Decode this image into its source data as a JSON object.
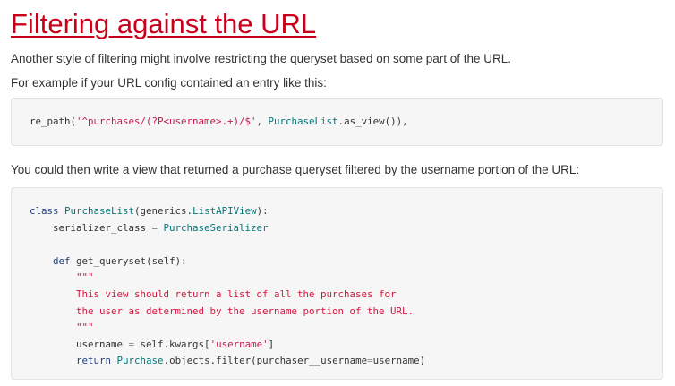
{
  "section": {
    "title": "Filtering against the URL",
    "intro": "Another style of filtering might involve restricting the queryset based on some part of the URL.",
    "example_lead": "For example if your URL config contained an entry like this:",
    "view_lead": "You could then write a view that returned a purchase queryset filtered by the username portion of the URL:"
  },
  "code1": {
    "func": "re_path(",
    "pattern": "'^purchases/(?P<username>.+)/$'",
    "sep": ", ",
    "cls": "PurchaseList",
    "rest": ".as_view()),"
  },
  "code2": {
    "l1_kw": "class",
    "l1_name": "PurchaseList",
    "l1_base_pre": "(generics.",
    "l1_base": "ListAPIView",
    "l1_end": "):",
    "l2_attr": "serializer_class",
    "l2_eq": " = ",
    "l2_val": "PurchaseSerializer",
    "l4_kw": "def",
    "l4_name": "get_queryset",
    "l4_args": "(self):",
    "doc_open": "\"\"\"",
    "doc_line1": "This view should return a list of all the purchases for",
    "doc_line2": "the user as determined by the username portion of the URL.",
    "doc_close": "\"\"\"",
    "l9_var": "username",
    "l9_eq": " = ",
    "l9_expr": "self.kwargs[",
    "l9_key": "'username'",
    "l9_end": "]",
    "l10_kw": "return",
    "l10_cls": "Purchase",
    "l10_call": ".objects.filter(purchaser__username",
    "l10_eq": "=",
    "l10_arg": "username)"
  }
}
